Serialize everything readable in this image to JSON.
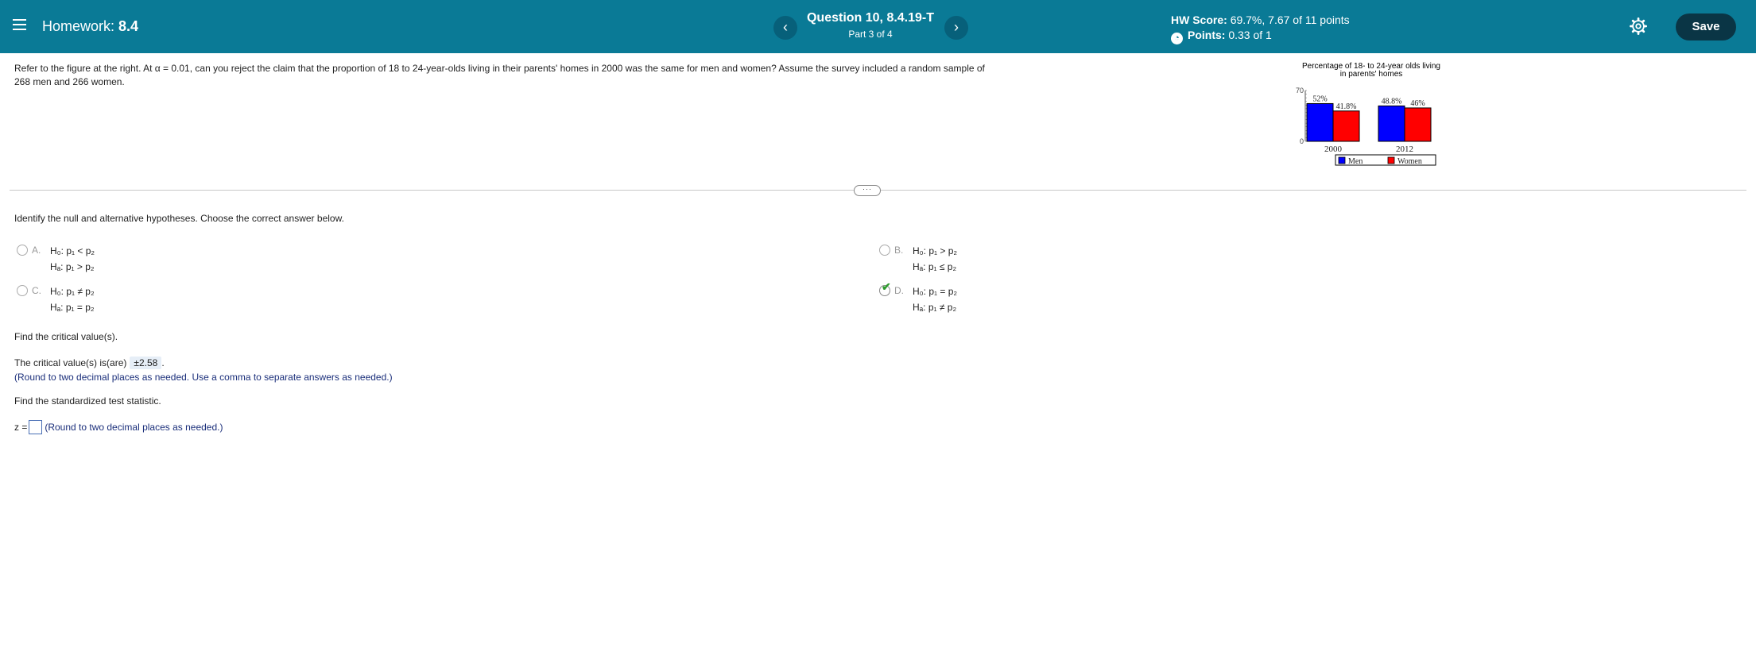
{
  "header": {
    "title_prefix": "Homework:",
    "title_value": "8.4",
    "question_title": "Question 10, 8.4.19-T",
    "question_part": "Part 3 of 4",
    "prev_label": "‹",
    "next_label": "›",
    "hw_score_label": "HW Score:",
    "hw_score_value": "69.7%, 7.67 of 11 points",
    "points_label": "Points:",
    "points_value": "0.33 of 1",
    "save_label": "Save",
    "colors": {
      "bar": "#0a7a96",
      "save": "#0a3545"
    }
  },
  "problem": {
    "text": "Refer to the figure at the right. At α = 0.01, can you  reject the claim that the proportion of 18 to 24-year-olds living in their parents' homes in 2000 was the same for men and women? Assume the survey included a random sample of 268 men and 266 women."
  },
  "chart_data": {
    "type": "bar",
    "title": "Percentage of 18- to 24-year olds living in parents' homes",
    "title_line1": "Percentage of 18- to 24-year olds living",
    "title_line2": "in parents' homes",
    "categories": [
      "2000",
      "2012"
    ],
    "series": [
      {
        "name": "Men",
        "values": [
          52,
          48.8
        ],
        "labels": [
          "52%",
          "48.8%"
        ],
        "color": "#0000ff"
      },
      {
        "name": "Women",
        "values": [
          41.8,
          46
        ],
        "labels": [
          "41.8%",
          "46%"
        ],
        "color": "#ff0000"
      }
    ],
    "ylim": [
      0,
      70
    ],
    "ytick_labels": [
      "70",
      "0"
    ],
    "legend_position": "bottom"
  },
  "question": {
    "prompt1": "Identify the null and alternative hypotheses. Choose the correct answer below.",
    "options": [
      {
        "letter": "A.",
        "h0": "p₁ < p₂",
        "ha": "p₁ > p₂"
      },
      {
        "letter": "B.",
        "h0": "p₁ > p₂",
        "ha": "p₁ ≤ p₂"
      },
      {
        "letter": "C.",
        "h0": "p₁ ≠ p₂",
        "ha": "p₁ = p₂"
      },
      {
        "letter": "D.",
        "h0": "p₁ = p₂",
        "ha": "p₁ ≠ p₂"
      }
    ],
    "h0_label": "H₀:",
    "ha_label": "Hₐ:",
    "selected_option": "D.",
    "prompt2": "Find the critical value(s).",
    "critical_prefix": "The critical value(s) is(are)",
    "critical_value": "±2.58",
    "critical_suffix": ".",
    "critical_hint": "(Round to two decimal places as needed. Use a comma to separate answers as needed.)",
    "prompt3": "Find the standardized test statistic.",
    "z_label": "z =",
    "z_hint": "(Round to two decimal places as needed.)",
    "z_value": ""
  }
}
